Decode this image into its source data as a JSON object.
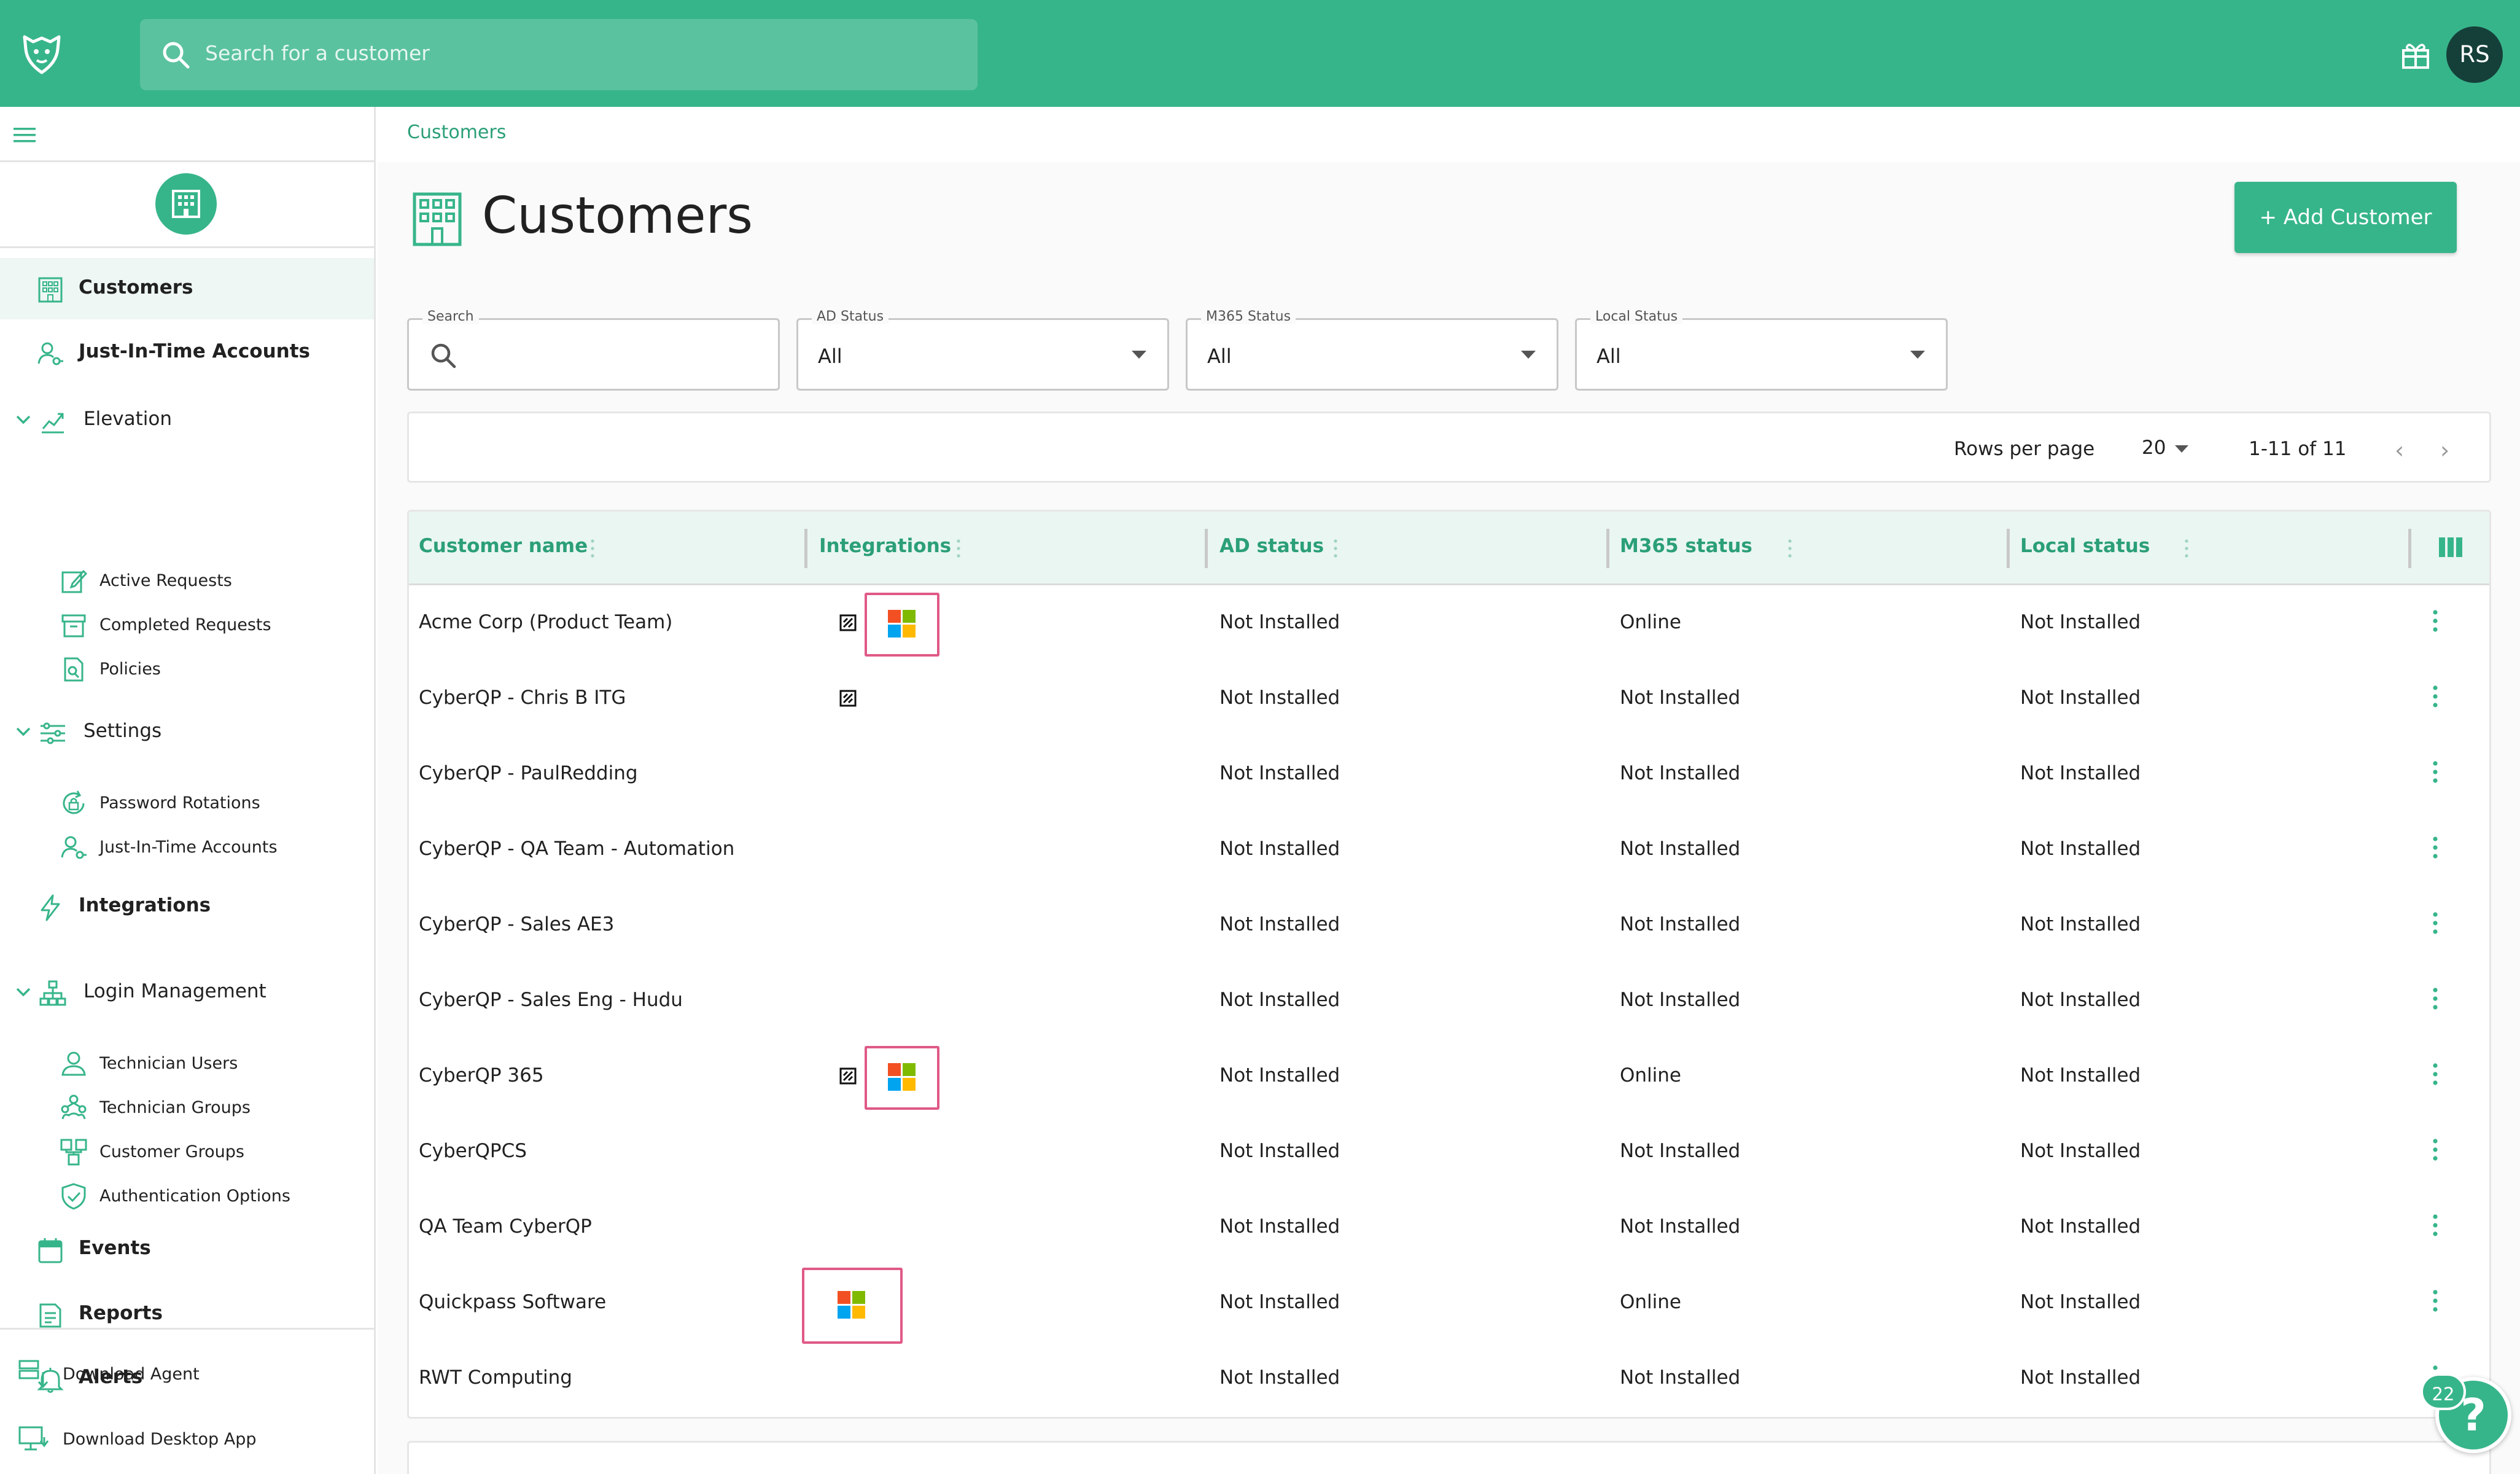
{
  "topbar": {
    "search_placeholder": "Search for a customer",
    "avatar_initials": "RS"
  },
  "sidebar": {
    "items": [
      {
        "label": "Customers",
        "icon": "building-icon",
        "active": true
      },
      {
        "label": "Just-In-Time Accounts",
        "icon": "user-key-icon"
      },
      {
        "label": "Elevation",
        "icon": "chart-up-icon",
        "children": [
          {
            "label": "Active Requests",
            "icon": "edit-doc-icon"
          },
          {
            "label": "Completed Requests",
            "icon": "archive-icon"
          },
          {
            "label": "Policies",
            "icon": "policy-doc-icon"
          }
        ]
      },
      {
        "label": "Settings",
        "icon": "sliders-icon",
        "children": [
          {
            "label": "Password Rotations",
            "icon": "rotate-lock-icon"
          },
          {
            "label": "Just-In-Time Accounts",
            "icon": "user-key-icon"
          }
        ]
      },
      {
        "label": "Integrations",
        "icon": "lightning-icon"
      },
      {
        "label": "Login Management",
        "icon": "org-chart-icon",
        "children": [
          {
            "label": "Technician Users",
            "icon": "user-icon"
          },
          {
            "label": "Technician Groups",
            "icon": "group-icon"
          },
          {
            "label": "Customer Groups",
            "icon": "customer-groups-icon"
          },
          {
            "label": "Authentication Options",
            "icon": "shield-check-icon"
          }
        ]
      },
      {
        "label": "Events",
        "icon": "calendar-icon"
      },
      {
        "label": "Reports",
        "icon": "report-icon"
      },
      {
        "label": "Alerts",
        "icon": "bell-icon"
      }
    ],
    "footer": [
      {
        "label": "Download Agent",
        "icon": "download-agent-icon"
      },
      {
        "label": "Download Desktop App",
        "icon": "desktop-download-icon"
      }
    ]
  },
  "breadcrumb": "Customers",
  "page_title": "Customers",
  "add_button": "+ Add Customer",
  "filters": {
    "search_label": "Search",
    "ad_label": "AD Status",
    "ad_value": "All",
    "m365_label": "M365 Status",
    "m365_value": "All",
    "local_label": "Local Status",
    "local_value": "All"
  },
  "pager": {
    "rows_per_page_label": "Rows per page",
    "rows_per_page": "20",
    "range": "1-11 of 11"
  },
  "table": {
    "columns": [
      "Customer name",
      "Integrations",
      "AD status",
      "M365 status",
      "Local status"
    ],
    "rows": [
      {
        "name": "Acme Corp (Product Team)",
        "hudu": true,
        "ms": true,
        "ad": "Not Installed",
        "m365": "Online",
        "local": "Not Installed"
      },
      {
        "name": "CyberQP - Chris B ITG",
        "hudu": true,
        "ms": false,
        "ad": "Not Installed",
        "m365": "Not Installed",
        "local": "Not Installed"
      },
      {
        "name": "CyberQP - PaulRedding",
        "hudu": false,
        "ms": false,
        "ad": "Not Installed",
        "m365": "Not Installed",
        "local": "Not Installed"
      },
      {
        "name": "CyberQP - QA Team - Automation",
        "hudu": false,
        "ms": false,
        "ad": "Not Installed",
        "m365": "Not Installed",
        "local": "Not Installed"
      },
      {
        "name": "CyberQP - Sales AE3",
        "hudu": false,
        "ms": false,
        "ad": "Not Installed",
        "m365": "Not Installed",
        "local": "Not Installed"
      },
      {
        "name": "CyberQP - Sales Eng - Hudu",
        "hudu": false,
        "ms": false,
        "ad": "Not Installed",
        "m365": "Not Installed",
        "local": "Not Installed"
      },
      {
        "name": "CyberQP 365",
        "hudu": true,
        "ms": true,
        "ad": "Not Installed",
        "m365": "Online",
        "local": "Not Installed"
      },
      {
        "name": "CyberQPCS",
        "hudu": false,
        "ms": false,
        "ad": "Not Installed",
        "m365": "Not Installed",
        "local": "Not Installed"
      },
      {
        "name": "QA Team CyberQP",
        "hudu": false,
        "ms": false,
        "ad": "Not Installed",
        "m365": "Not Installed",
        "local": "Not Installed"
      },
      {
        "name": "Quickpass Software",
        "hudu": false,
        "ms": true,
        "ad": "Not Installed",
        "m365": "Online",
        "local": "Not Installed"
      },
      {
        "name": "RWT Computing",
        "hudu": false,
        "ms": false,
        "ad": "Not Installed",
        "m365": "Not Installed",
        "local": "Not Installed"
      }
    ]
  },
  "help": {
    "badge": "22",
    "symbol": "?"
  },
  "colors": {
    "brand": "#37b58a",
    "brand_dark": "#2b9f78",
    "highlight": "#e05a86"
  }
}
